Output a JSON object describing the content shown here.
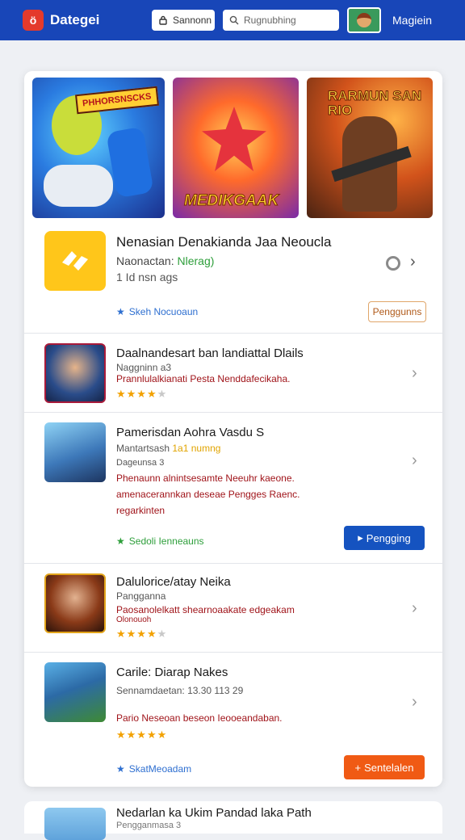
{
  "header": {
    "logo_text": "Dategei",
    "search_button_label": "Sannonn",
    "search_placeholder": "Rugnubhing",
    "user_name": "Magiein",
    "brand_color": "#1846b8"
  },
  "banners": [
    {
      "tag": "PHHORSNSCKS"
    },
    {
      "tag": "MEDIKGAAK"
    },
    {
      "tag": "RARMUN SAN RIO"
    }
  ],
  "featured": {
    "title": "Nenasian Denakianda Jaa Neoucla",
    "developer_label": "Naonactan:",
    "developer_value": "Nlerag)",
    "size": "1 Id nsn ags",
    "note": "Skeh Nocuoaun",
    "button": "Penggunns"
  },
  "rows": [
    {
      "title": "Daalnandesart ban landiattal Dlails",
      "sub": "Naggninn a3",
      "desc": "Prannlulalkianati Pesta Nenddafecikaha.",
      "rating": 4
    },
    {
      "title": "Pamerisdan Aohra Vasdu S",
      "sub": "Mantartsash",
      "sub_highlight": "1a1 numng",
      "sub2": "Dageunsa 3",
      "desc": "Phenaunn alnintsesamte Neeuhr kaeone.",
      "desc2": "amenacerannkan deseae Pengges Raenc.",
      "desc3": "regarkinten",
      "note": "Sedoli Ienneauns",
      "button": "Pengging"
    },
    {
      "title": "Dalulorice/atay Neika",
      "sub": "Pangganna",
      "desc": "Paosanolelkatt shearnoaakate edgeakam",
      "desc2": "Olonouoh",
      "rating": 4
    },
    {
      "title": "Carile: Diarap Nakes",
      "sub": "Sennamdaetan: 13.30 113 29",
      "desc": "Pario Neseoan beseon Ieooeandaban.",
      "rating": 5,
      "note": "SkatMeoadam",
      "button": "Sentelalen"
    }
  ],
  "peek": {
    "title": "Nedarlan ka Ukim Pandad laka Path",
    "sub": "Pengganmasa 3"
  }
}
